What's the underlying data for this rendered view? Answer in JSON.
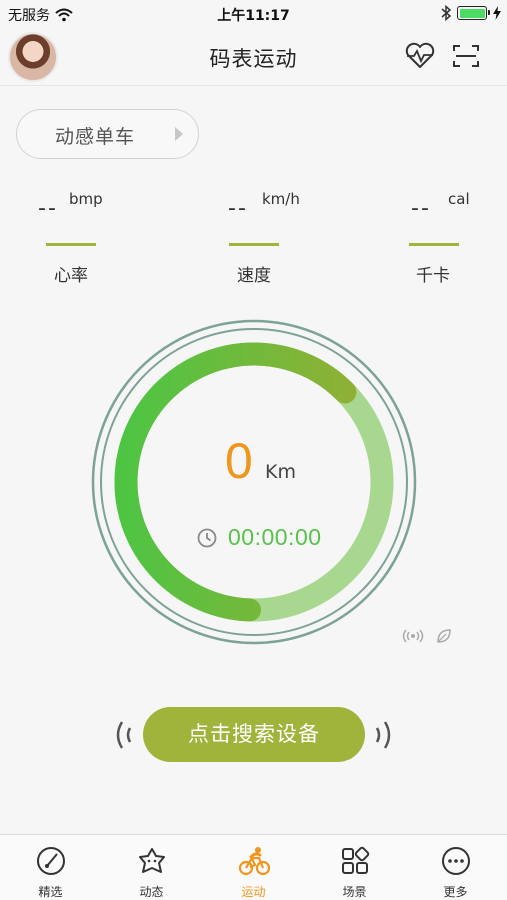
{
  "status_bar": {
    "carrier": "无服务",
    "time": "上午11:17"
  },
  "header": {
    "title": "码表运动",
    "heart_icon": "heart-rate-icon",
    "scan_icon": "scan-icon"
  },
  "device": {
    "label": "动感单车",
    "arrow_icon": "triangle-right-icon"
  },
  "stats": [
    {
      "value": "--",
      "unit": "bmp",
      "label": "心率"
    },
    {
      "value": "--",
      "unit": "km/h",
      "label": "速度"
    },
    {
      "value": "--",
      "unit": "cal",
      "label": "千卡"
    }
  ],
  "ring": {
    "distance": "0",
    "unit": "Km",
    "timer": "00:00:00",
    "progress": 0.62
  },
  "search_button": {
    "label": "点击搜索设备"
  },
  "tabs": [
    {
      "label": "精选",
      "icon": "compass-icon",
      "active": false
    },
    {
      "label": "动态",
      "icon": "star-face-icon",
      "active": false
    },
    {
      "label": "运动",
      "icon": "cycling-icon",
      "active": true
    },
    {
      "label": "场景",
      "icon": "grid-icon",
      "active": false
    },
    {
      "label": "更多",
      "icon": "more-dots-icon",
      "active": false
    }
  ],
  "colors": {
    "accent_green": "#a0b33b",
    "orange": "#f0961e",
    "timer_green": "#58c24a",
    "ring_outline": "#6f9b8c"
  }
}
